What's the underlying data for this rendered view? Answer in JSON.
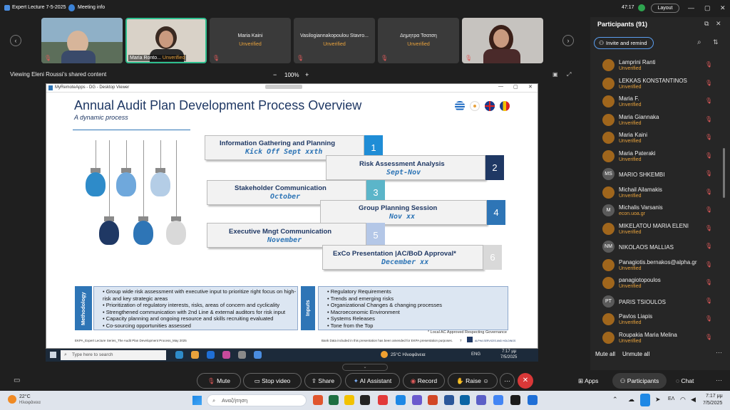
{
  "window": {
    "title": "Expert Lecture 7-5-2025",
    "meeting_info": "Meeting info",
    "timer": "47:17",
    "layout_label": "Layout"
  },
  "gallery": {
    "tiles": [
      {
        "name": "",
        "status": ""
      },
      {
        "name": "Maria Ronto...",
        "status": "Unverified"
      },
      {
        "name": "Maria Kaini",
        "status": "Unverified"
      },
      {
        "name": "Vasilogiannakopoulou Stavro...",
        "status": "Unverified"
      },
      {
        "name": "Δημητρα Τσατση",
        "status": "Unverified"
      },
      {
        "name": "",
        "status": ""
      }
    ]
  },
  "share": {
    "viewing_label": "Viewing Eleni Roussi's shared content",
    "zoom": "100%",
    "zoom_minus": "−",
    "zoom_plus": "+",
    "viewer_title": "MyRemoteApps - DG - Desktop Viewer"
  },
  "slide": {
    "title": "Annual Audit Plan Development Process Overview",
    "subtitle": "A dynamic process",
    "steps": [
      {
        "label": "Information Gathering and Planning",
        "date": "Kick Off Sept xxth",
        "num": "1",
        "color": "#1f8dd6"
      },
      {
        "label": "Risk Assessment Analysis",
        "date": "Sept-Nov",
        "num": "2",
        "color": "#1f3864"
      },
      {
        "label": "Stakeholder Communication",
        "date": "October",
        "num": "3",
        "color": "#5bb5c9"
      },
      {
        "label": "Group Planning Session",
        "date": "Nov xx",
        "num": "4",
        "color": "#2e75b6"
      },
      {
        "label": "Executive Mngt Communication",
        "date": "November",
        "num": "5",
        "color": "#b4c7e7"
      },
      {
        "label": "ExCo Presentation |AC/BoD Approval*",
        "date": "December xx",
        "num": "6",
        "color": "#d9d9d9"
      }
    ],
    "methodology_label": "Methodology",
    "methodology_items": [
      "Group wide risk assessment with executive input to prioritize right focus on high-risk and key strategic areas",
      "Prioritization of regulatory interests, risks, areas of concern and cyclicality",
      "Strengthened communication with 2nd Line & external auditors for risk input",
      "Capacity planning and ongoing resource and skills recruiting evaluated",
      "Co-sourcing opportunities assessed"
    ],
    "inputs_label": "Inputs",
    "inputs_items": [
      "Regulatory Requirements",
      "Trends and emerging risks",
      "Organizational Changes & changing processes",
      "Macroeconomic Environment",
      "Systems Releases",
      "Tone from the Top"
    ],
    "footnote": "* Local AC Approved Respecting Governance",
    "footer_left": "EKPA_Expert Lecture Series_The Audit Plan Development Process_May 2025",
    "footer_mid": "Bank Data included in this presentation has been amended for EKPA presentation purposes.",
    "footer_page": "7",
    "footer_brand": "ALPHA SERVICES AND HOLDINGS"
  },
  "remote_taskbar": {
    "search_placeholder": "Type here to search",
    "weather": "25°C Ηλιοφάνεια",
    "lang": "ENG",
    "time": "7:17 μμ",
    "date": "7/5/2025"
  },
  "participants": {
    "title": "Participants (91)",
    "invite_label": "Invite and remind",
    "list": [
      {
        "name": "Lamprini Ranti",
        "status": "Unverified",
        "initials": "",
        "color": "#a0661c"
      },
      {
        "name": "LEKKAS KONSTANTINOS",
        "status": "Unverified",
        "initials": "",
        "color": "#a0661c"
      },
      {
        "name": "Maria F.",
        "status": "Unverified",
        "initials": "",
        "color": "#a0661c"
      },
      {
        "name": "Maria Giannaka",
        "status": "Unverified",
        "initials": "",
        "color": "#a0661c"
      },
      {
        "name": "Maria Kaini",
        "status": "Unverified",
        "initials": "",
        "color": "#a0661c"
      },
      {
        "name": "Maria Pateraki",
        "status": "Unverified",
        "initials": "",
        "color": "#a0661c"
      },
      {
        "name": "MARIO SHKEMBI",
        "status": "",
        "initials": "MS",
        "color": "#5a5a5a"
      },
      {
        "name": "Michail Ailamakis",
        "status": "Unverified",
        "initials": "",
        "color": "#a0661c"
      },
      {
        "name": "Michalis Varsanis",
        "status": "econ.uoa.gr",
        "initials": "M",
        "color": "#5a5a5a"
      },
      {
        "name": "MIKELATOU MARIA ELENI",
        "status": "Unverified",
        "initials": "",
        "color": "#a0661c"
      },
      {
        "name": "NIKOLAOS MALLIAS",
        "status": "",
        "initials": "NM",
        "color": "#5a5a5a"
      },
      {
        "name": "Panagiotis.bernakos@alpha.gr",
        "status": "Unverified",
        "initials": "",
        "color": "#a0661c"
      },
      {
        "name": "panagiotopoulos",
        "status": "Unverified",
        "initials": "",
        "color": "#a0661c"
      },
      {
        "name": "PARIS TSIOULOS",
        "status": "",
        "initials": "PT",
        "color": "#5a5a5a"
      },
      {
        "name": "Pavlos Liapis",
        "status": "Unverified",
        "initials": "",
        "color": "#a0661c"
      },
      {
        "name": "Roupakia Maria Melina",
        "status": "Unverified",
        "initials": "",
        "color": "#a0661c"
      }
    ],
    "mute_all": "Mute all",
    "unmute_all": "Unmute all"
  },
  "controls": {
    "mute": "Mute",
    "stop_video": "Stop video",
    "share": "Share",
    "ai_assistant": "AI Assistant",
    "record": "Record",
    "raise": "Raise",
    "apps": "Apps",
    "participants": "Participants",
    "chat": "Chat"
  },
  "taskbar": {
    "weather_temp": "22°C",
    "weather_desc": "Ηλιοφάνεια",
    "search_placeholder": "Αναζήτηση",
    "lang": "ΕΛ",
    "time": "7:17 μμ",
    "date": "7/5/2025"
  }
}
